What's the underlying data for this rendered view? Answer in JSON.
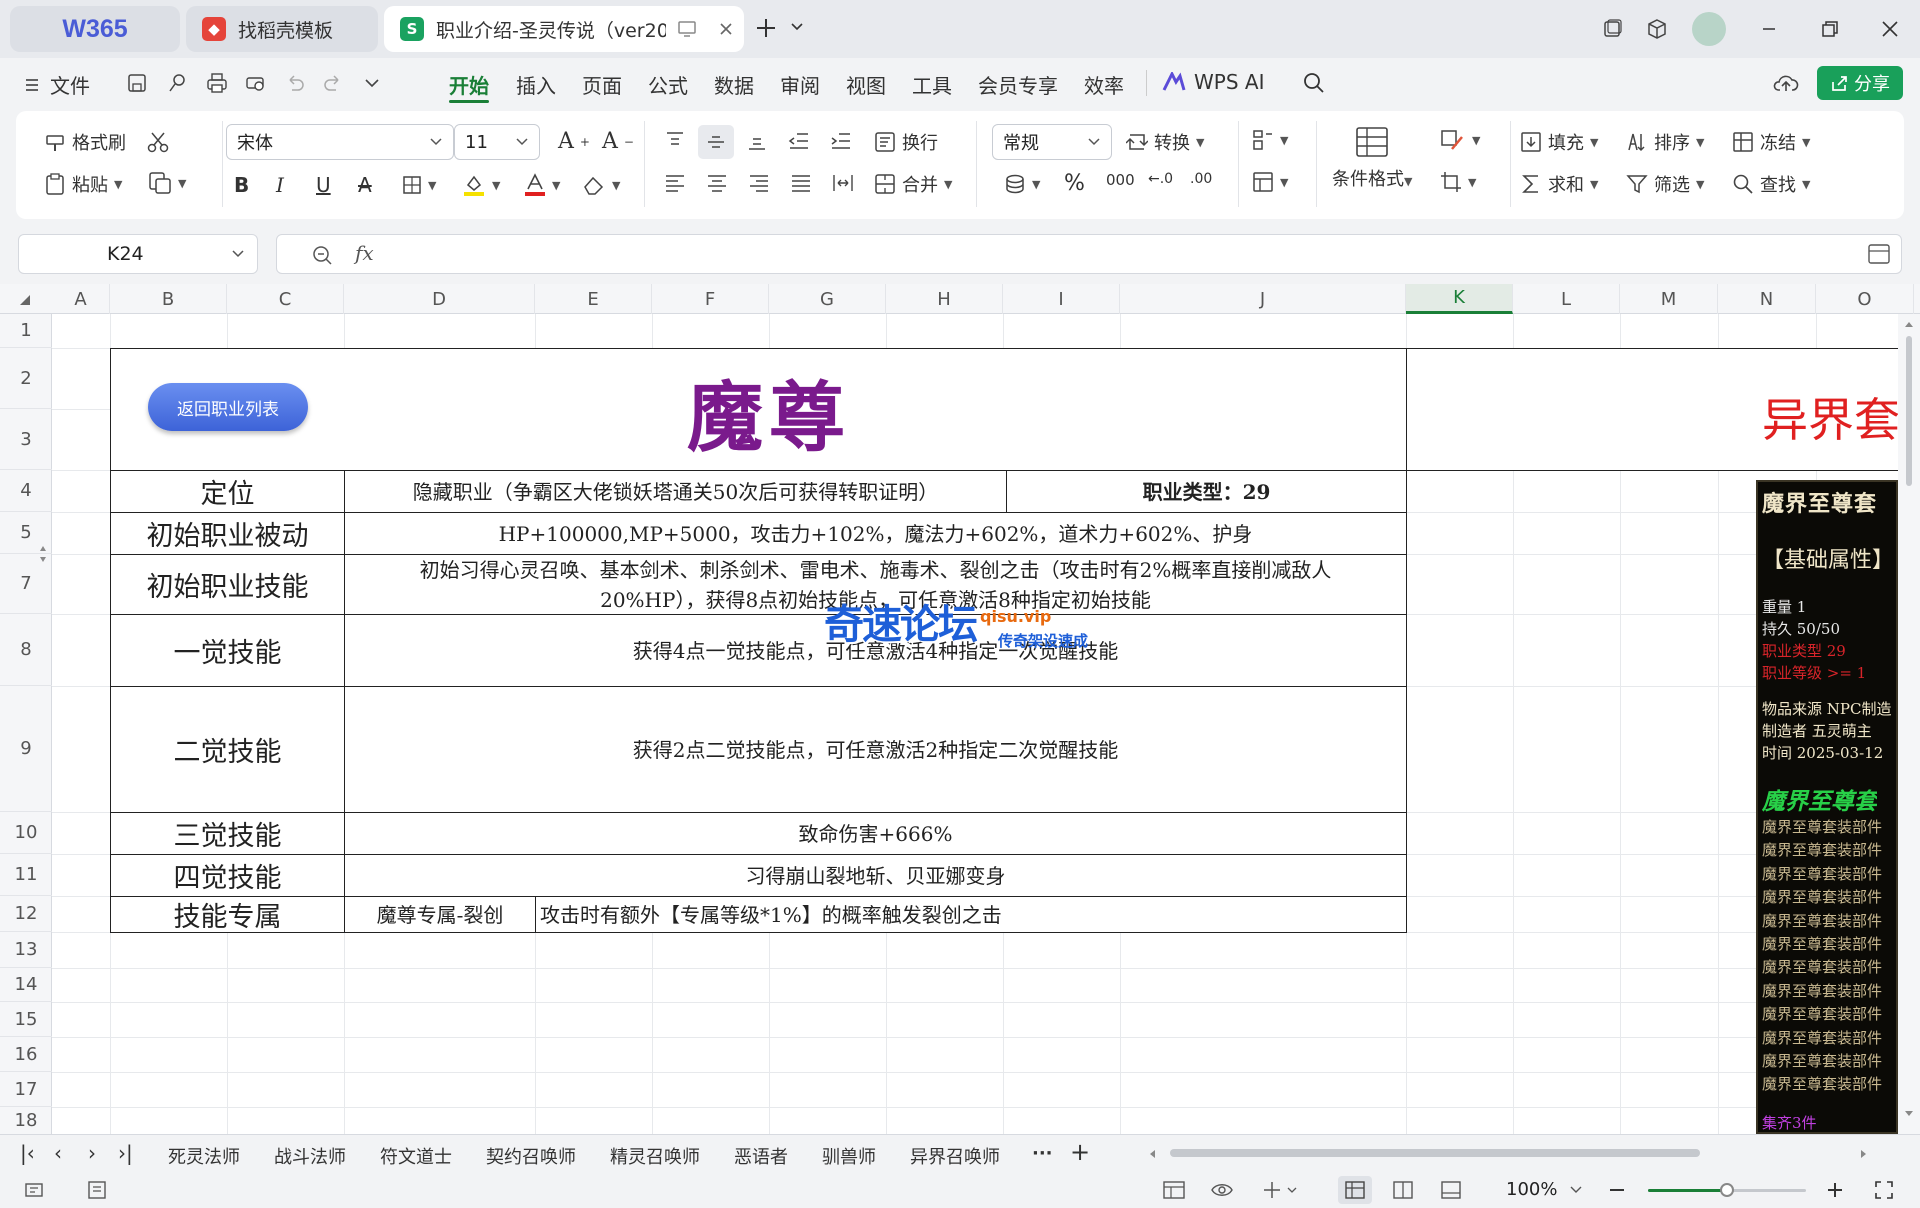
{
  "tabs": {
    "w365": "W365",
    "daoke": "找稻壳模板",
    "doc": "职业介绍-圣灵传说（ver20"
  },
  "menu": {
    "file": "文件",
    "items": [
      "开始",
      "插入",
      "页面",
      "公式",
      "数据",
      "审阅",
      "视图",
      "工具",
      "会员专享",
      "效率"
    ],
    "wps_ai": "WPS AI",
    "share": "分享"
  },
  "ribbon": {
    "format_painter": "格式刷",
    "paste": "粘贴",
    "font": "宋体",
    "size": "11",
    "wrap": "换行",
    "merge": "合并",
    "number_format": "常规",
    "convert": "转换",
    "cond_format": "条件格式",
    "fill": "填充",
    "sort": "排序",
    "freeze": "冻结",
    "sum": "求和",
    "filter": "筛选",
    "find": "查找"
  },
  "formula_bar": {
    "cell_ref": "K24",
    "fx": "fx",
    "content": ""
  },
  "columns": [
    "A",
    "B",
    "C",
    "D",
    "E",
    "F",
    "G",
    "H",
    "I",
    "J",
    "K",
    "L",
    "M",
    "N",
    "O"
  ],
  "selected_column": "K",
  "rows": [
    "1",
    "2",
    "3",
    "4",
    "5",
    "7",
    "8",
    "9",
    "10",
    "11",
    "12",
    "13",
    "14",
    "15",
    "16",
    "17",
    "18"
  ],
  "sheet": {
    "back_button": "返回职业列表",
    "title": "魔尊",
    "right_title": "异界套",
    "table": {
      "row4": {
        "label": "定位",
        "value": "隐藏职业（争霸区大佬锁妖塔通关50次后可获得转职证明）",
        "extra": "职业类型：29"
      },
      "row5": {
        "label": "初始职业被动",
        "value": "HP+100000,MP+5000，攻击力+102%，魔法力+602%，道术力+602%、护身"
      },
      "row7": {
        "label": "初始职业技能",
        "value": "初始习得心灵召唤、基本剑术、刺杀剑术、雷电术、施毒术、裂创之击（攻击时有2%概率直接削减敌人20%HP），获得8点初始技能点，可任意激活8种指定初始技能"
      },
      "row8": {
        "label": "一觉技能",
        "value": "获得4点一觉技能点，可任意激活4种指定一次觉醒技能"
      },
      "row9": {
        "label": "二觉技能",
        "value": "获得2点二觉技能点，可任意激活2种指定二次觉醒技能"
      },
      "row10": {
        "label": "三觉技能",
        "value": "致命伤害+666%"
      },
      "row11": {
        "label": "四觉技能",
        "value": "习得崩山裂地斩、贝亚娜变身"
      },
      "row12": {
        "label": "技能专属",
        "name": "魔尊专属-裂创",
        "value": "攻击时有额外【专属等级*1%】的概率触发裂创之击"
      }
    },
    "watermark": {
      "main": "奇速论坛",
      "site": "qisu.vip",
      "sub": "传奇架设速成"
    },
    "game_card": {
      "title": "魔界至尊套",
      "section": "【基础属性】",
      "weight": "重量  1",
      "durability": "持久  50/50",
      "job_type": "职业类型  29",
      "job_level": "职业等级 >= 1",
      "source": "物品来源  NPC制造",
      "maker": "制造者  五灵萌主",
      "time": "时间  2025-03-12",
      "set_name": "魔界至尊套",
      "set_item": "魔界至尊套装部件",
      "set_item_count": 12,
      "footer": "集齐3件"
    }
  },
  "sheet_tabs": [
    "死灵法师",
    "战斗法师",
    "符文道士",
    "契约召唤师",
    "精灵召唤师",
    "恶语者",
    "驯兽师",
    "异界召唤师"
  ],
  "more_tabs": "···",
  "add_tab": "+",
  "status": {
    "zoom": "100%",
    "zoom_fraction": 0.5
  },
  "colors": {
    "accent": "#1a7f37",
    "title_purple": "#7a1a8c",
    "title_red": "#e02020",
    "share_green": "#19a05a",
    "button_blue": "#3d63d8"
  }
}
